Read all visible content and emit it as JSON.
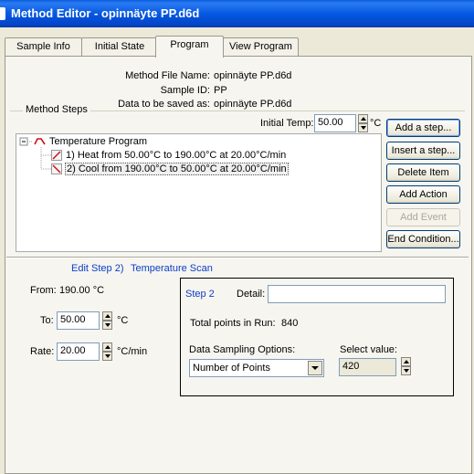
{
  "window": {
    "title": "Method Editor - opinnäyte PP.d6d"
  },
  "tabs": [
    "Sample Info",
    "Initial State",
    "Program",
    "View Program"
  ],
  "info": {
    "file_label": "Method File Name:",
    "file_value": "opinnäyte PP.d6d",
    "sample_label": "Sample ID:",
    "sample_value": "PP",
    "saved_label": "Data to be saved as:",
    "saved_value": "opinnäyte PP.d6d"
  },
  "method_steps": {
    "title": "Method Steps",
    "initial_temp_label": "Initial Temp:",
    "initial_temp_value": "50.00",
    "initial_temp_unit": "°C"
  },
  "tree": {
    "root": "Temperature Program",
    "steps": [
      "1) Heat from 50.00°C to 190.00°C at 20.00°C/min",
      "2) Cool from 190.00°C to 50.00°C at 20.00°C/min"
    ]
  },
  "buttons": [
    "Add a step...",
    "Insert a step...",
    "Delete Item",
    "Add Action",
    "Add Event",
    "End Condition..."
  ],
  "edit": {
    "header_step": "Edit Step 2)",
    "header_type": "Temperature Scan",
    "from_label": "From:",
    "from_value": "190.00 °C",
    "to_label": "To:",
    "to_value": "50.00",
    "to_unit": "°C",
    "rate_label": "Rate:",
    "rate_value": "20.00",
    "rate_unit": "°C/min"
  },
  "step_box": {
    "title": "Step 2",
    "detail_label": "Detail:",
    "detail_value": "",
    "points_label": "Total points in Run:",
    "points_value": "840",
    "sampling_label": "Data Sampling Options:",
    "sampling_value": "Number of Points",
    "select_label": "Select value:",
    "select_value": "420"
  },
  "colors": {
    "accent_blue": "#0b3ec9",
    "titlebar": "#0558e2"
  }
}
